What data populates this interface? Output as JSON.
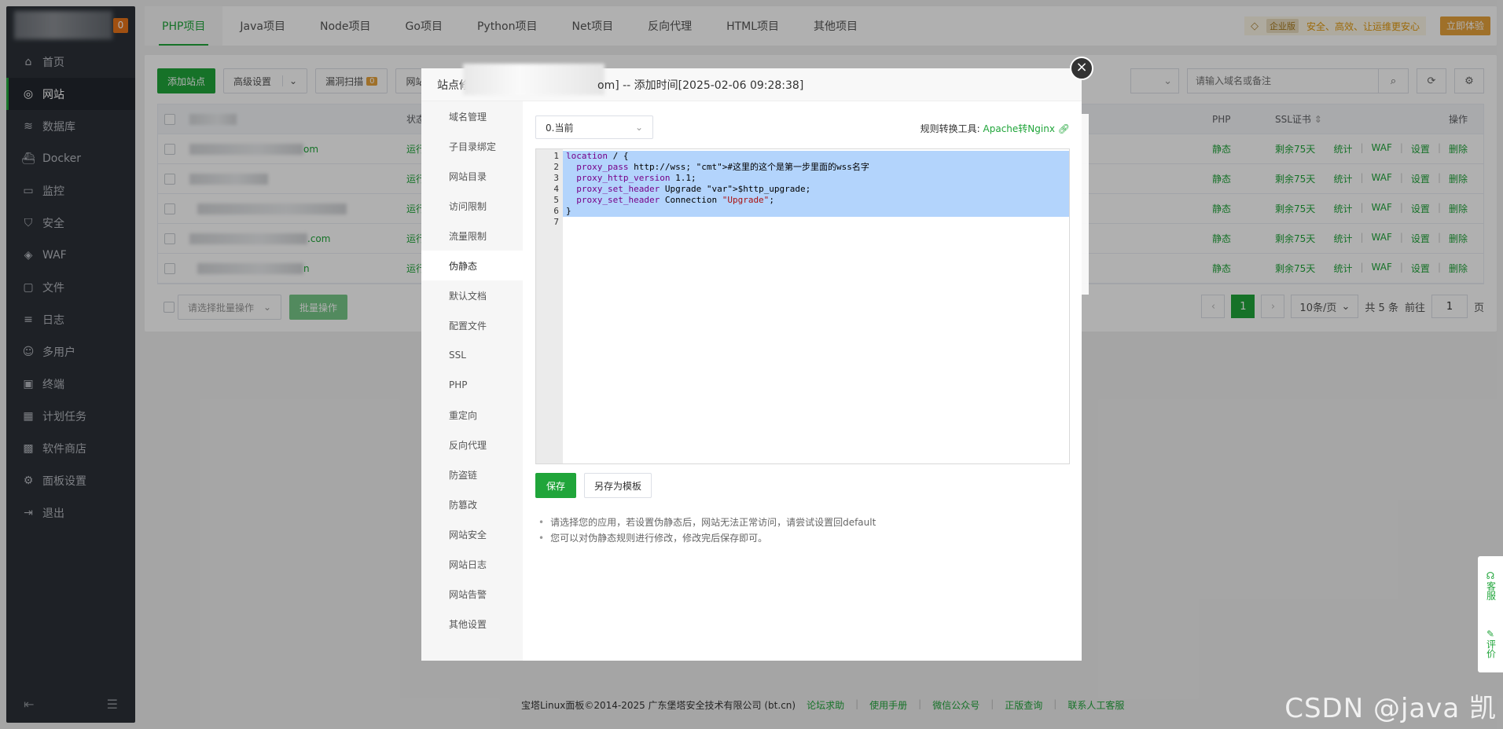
{
  "sidebar": {
    "badge": "0",
    "items": [
      {
        "label": "首页",
        "icon": "home-icon"
      },
      {
        "label": "网站",
        "icon": "globe-icon",
        "active": true
      },
      {
        "label": "数据库",
        "icon": "database-icon"
      },
      {
        "label": "Docker",
        "icon": "docker-icon"
      },
      {
        "label": "监控",
        "icon": "monitor-icon"
      },
      {
        "label": "安全",
        "icon": "shield-icon"
      },
      {
        "label": "WAF",
        "icon": "waf-icon"
      },
      {
        "label": "文件",
        "icon": "folder-icon"
      },
      {
        "label": "日志",
        "icon": "log-icon"
      },
      {
        "label": "多用户",
        "icon": "users-icon"
      },
      {
        "label": "终端",
        "icon": "terminal-icon"
      },
      {
        "label": "计划任务",
        "icon": "calendar-icon"
      },
      {
        "label": "软件商店",
        "icon": "store-icon"
      },
      {
        "label": "面板设置",
        "icon": "gear-icon"
      },
      {
        "label": "退出",
        "icon": "logout-icon"
      }
    ]
  },
  "tabs": [
    "PHP项目",
    "Java项目",
    "Node项目",
    "Go项目",
    "Python项目",
    "Net项目",
    "反向代理",
    "HTML项目",
    "其他项目"
  ],
  "enterprise": {
    "vip": "企业版",
    "slogan": "安全、高效、让运维更安心",
    "try": "立即体验"
  },
  "toolbar": {
    "add_site": "添加站点",
    "advanced": "高级设置",
    "vuln_scan": "漏洞扫描",
    "vuln_count": "0",
    "site_prefix": "网站"
  },
  "search": {
    "placeholder": "请输入域名或备注"
  },
  "table": {
    "headers": {
      "status": "状态",
      "php": "PHP",
      "ssl": "SSL证书",
      "ops": "操作"
    },
    "rows": [
      {
        "suffix": "om",
        "status": "运行",
        "php": "静态",
        "ssl": "剩余75天"
      },
      {
        "suffix": "",
        "status": "运行",
        "php": "静态",
        "ssl": "剩余75天"
      },
      {
        "suffix": "",
        "status": "运行",
        "php": "静态",
        "ssl": "剩余75天"
      },
      {
        "suffix": ".com",
        "status": "运行",
        "php": "静态",
        "ssl": "剩余75天"
      },
      {
        "suffix": "n",
        "status": "运行",
        "php": "静态",
        "ssl": "剩余75天"
      }
    ],
    "op_labels": [
      "统计",
      "WAF",
      "设置",
      "删除"
    ]
  },
  "batch": {
    "placeholder": "请选择批量操作",
    "button": "批量操作"
  },
  "pager": {
    "current": "1",
    "per_page": "10条/页",
    "total": "共 5 条",
    "goto_label": "前往",
    "goto_value": "1",
    "page_unit": "页"
  },
  "modal": {
    "title_prefix": "站点修",
    "title_suffix": "om] -- 添加时间[2025-02-06 09:28:38]",
    "close": "×",
    "nav": [
      "域名管理",
      "子目录绑定",
      "网站目录",
      "访问限制",
      "流量限制",
      "伪静态",
      "默认文档",
      "配置文件",
      "SSL",
      "PHP",
      "重定向",
      "反向代理",
      "防盗链",
      "防篡改",
      "网站安全",
      "网站日志",
      "网站告警",
      "其他设置"
    ],
    "nav_active": 5,
    "version": "0.当前",
    "tool_label": "规则转换工具:",
    "tool_link": "Apache转Nginx",
    "code_lines": [
      "location / {",
      "  proxy_pass http://wss; #这里的这个是第一步里面的wss名字",
      "  proxy_http_version 1.1;",
      "  proxy_set_header Upgrade $http_upgrade;",
      "  proxy_set_header Connection \"Upgrade\";",
      "}",
      ""
    ],
    "line_numbers": [
      "1",
      "2",
      "3",
      "4",
      "5",
      "6",
      "7"
    ],
    "save": "保存",
    "save_template": "另存为模板",
    "tips": [
      "请选择您的应用，若设置伪静态后，网站无法正常访问，请尝试设置回default",
      "您可以对伪静态规则进行修改，修改完后保存即可。"
    ]
  },
  "footer": {
    "copyright": "宝塔Linux面板©2014-2025 广东堡塔安全技术有限公司 (bt.cn)",
    "links": [
      "论坛求助",
      "使用手册",
      "微信公众号",
      "正版查询",
      "联系人工客服"
    ]
  },
  "float": {
    "service": "客服",
    "rate": "评价"
  },
  "watermark": "CSDN @java 凯",
  "colors": {
    "accent": "#20a53a",
    "sidebar_bg": "#2c3138",
    "warning": "#e6a23c"
  }
}
